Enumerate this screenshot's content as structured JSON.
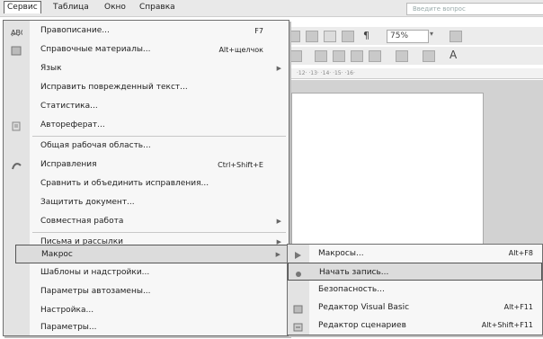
{
  "menubar": {
    "items": [
      "Сервис",
      "Таблица",
      "Окно",
      "Справка"
    ],
    "active": "Сервис",
    "ask_placeholder": "Введите вопрос"
  },
  "toolbar": {
    "zoom": "75%",
    "pilcrow": "¶",
    "ruler_marks": "·12· ·13· ·14· ·15· ·16·"
  },
  "service_menu": {
    "items": [
      {
        "label": "Правописание...",
        "shortcut": "F7",
        "icon": "spelling-icon"
      },
      {
        "label": "Справочные материалы...",
        "shortcut": "Alt+щелчок",
        "icon": "research-icon"
      },
      {
        "label": "Язык",
        "submenu": true
      },
      {
        "label": "Исправить поврежденный текст..."
      },
      {
        "label": "Статистика..."
      },
      {
        "label": "Автореферат...",
        "icon": "autosummary-icon"
      },
      {
        "label": "Общая рабочая область..."
      },
      {
        "label": "Исправления",
        "shortcut": "Ctrl+Shift+E",
        "icon": "track-changes-icon"
      },
      {
        "label": "Сравнить и объединить исправления..."
      },
      {
        "label": "Защитить документ..."
      },
      {
        "label": "Совместная работа",
        "submenu": true
      },
      {
        "label": "Письма и рассылки",
        "submenu": true
      },
      {
        "label": "Макрос",
        "submenu": true,
        "highlighted": true
      },
      {
        "label": "Шаблоны и надстройки..."
      },
      {
        "label": "Параметры автозамены..."
      },
      {
        "label": "Настройка..."
      },
      {
        "label": "Параметры..."
      }
    ]
  },
  "macro_submenu": {
    "items": [
      {
        "label": "Макросы...",
        "shortcut": "Alt+F8",
        "icon": "play-icon"
      },
      {
        "label": "Начать запись...",
        "highlighted": true,
        "icon": "record-icon"
      },
      {
        "label": "Безопасность..."
      },
      {
        "label": "Редактор Visual Basic",
        "shortcut": "Alt+F11",
        "icon": "vb-editor-icon"
      },
      {
        "label": "Редактор сценариев",
        "shortcut": "Alt+Shift+F11",
        "icon": "script-editor-icon"
      }
    ]
  },
  "colors": {
    "menu_bg": "#f7f7f7",
    "gutter": "#e3e3e3",
    "highlight": "#dcdcdc",
    "border": "#6f6f6f"
  }
}
